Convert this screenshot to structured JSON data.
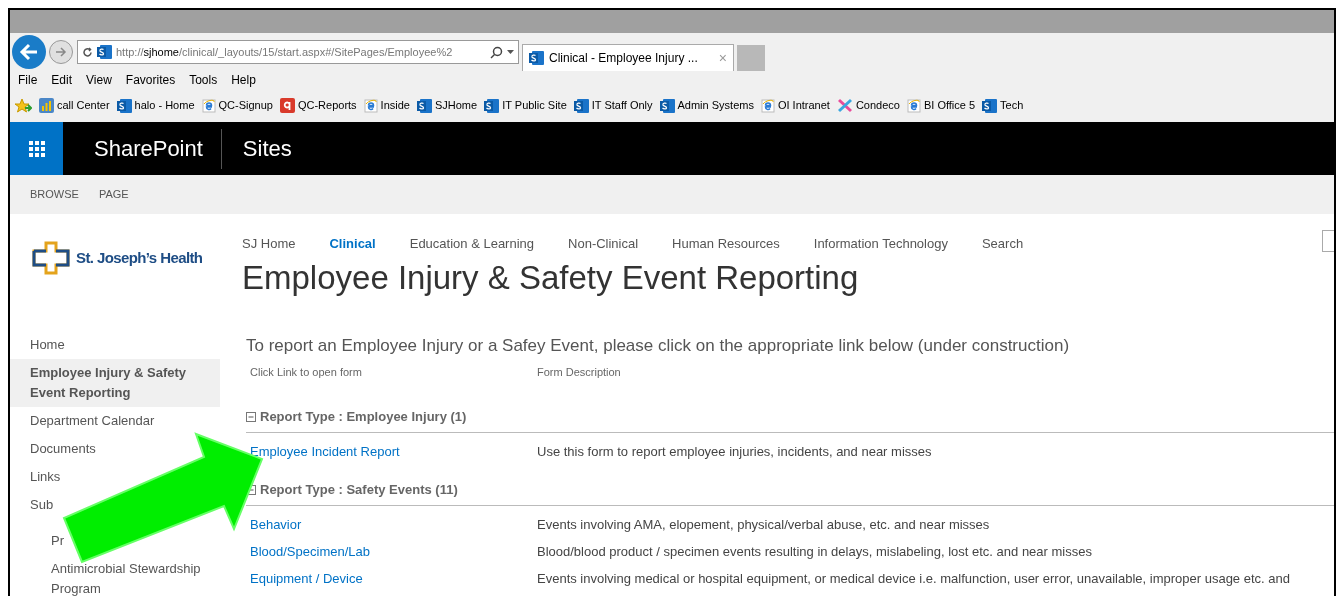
{
  "browser": {
    "address": "http://**sjhome**/clinical/_layouts/15/start.aspx#/SitePages/Employee%2",
    "tabs": [
      {
        "title": "Clinical - Employee Injury ...",
        "selected": true,
        "close": "×"
      }
    ],
    "menu": [
      "File",
      "Edit",
      "View",
      "Favorites",
      "Tools",
      "Help"
    ],
    "favorites": [
      {
        "label": "call Center",
        "kind": "chart"
      },
      {
        "label": "halo - Home",
        "kind": "sp"
      },
      {
        "label": "QC-Signup",
        "kind": "ie"
      },
      {
        "label": "QC-Reports",
        "kind": "q"
      },
      {
        "label": "Inside",
        "kind": "ie"
      },
      {
        "label": "SJHome",
        "kind": "sp"
      },
      {
        "label": "IT Public Site",
        "kind": "sp"
      },
      {
        "label": "IT Staff Only",
        "kind": "sp"
      },
      {
        "label": "Admin Systems",
        "kind": "sp"
      },
      {
        "label": "OI Intranet",
        "kind": "ie"
      },
      {
        "label": "Condeco",
        "kind": "condeco"
      },
      {
        "label": "BI Office 5",
        "kind": "ie"
      },
      {
        "label": "Tech",
        "kind": "sp"
      }
    ]
  },
  "suite_bar": {
    "brand": "SharePoint",
    "section": "Sites"
  },
  "ribbon": {
    "tabs": [
      "BROWSE",
      "PAGE"
    ]
  },
  "logo": {
    "text": "St. Joseph’s Health"
  },
  "sidebar": {
    "items": [
      {
        "label": "Home",
        "selected": false
      },
      {
        "label": "Employee Injury & Safety Event Reporting",
        "selected": true
      },
      {
        "label": "Department Calendar",
        "selected": false
      },
      {
        "label": "Documents",
        "selected": false
      },
      {
        "label": "Links",
        "selected": false
      },
      {
        "label": "Sub",
        "selected": false,
        "children": [
          {
            "label": "Pr",
            "selected": false
          },
          {
            "label": "Antimicrobial Stewardship Program",
            "selected": false
          }
        ]
      }
    ]
  },
  "top_nav": [
    {
      "label": "SJ Home",
      "selected": false
    },
    {
      "label": "Clinical",
      "selected": true
    },
    {
      "label": "Education & Learning",
      "selected": false
    },
    {
      "label": "Non-Clinical",
      "selected": false
    },
    {
      "label": "Human Resources",
      "selected": false
    },
    {
      "label": "Information Technology",
      "selected": false
    },
    {
      "label": "Search",
      "selected": false
    }
  ],
  "page_title": "Employee Injury & Safety Event Reporting",
  "intro": "To report an Employee Injury or a Safey Event, please click on the appropriate link below (under construction)",
  "columns": [
    "Click Link to open form",
    "Form Description"
  ],
  "groups": [
    {
      "heading": "Report Type : **Employee Injury** (1)",
      "expanded": true,
      "rows": [
        {
          "link": "Employee Incident Report",
          "description": "Use this form to report employee injuries, incidents, and near misses"
        }
      ]
    },
    {
      "heading": "Report Type : **Safety Events** (11)",
      "expanded": true,
      "rows": [
        {
          "link": "Behavior",
          "description": "Events involving AMA, elopement, physical/verbal abuse, etc. and near misses"
        },
        {
          "link": "Blood/Specimen/Lab",
          "description": "Blood/blood product / specimen events resulting in delays, mislabeling, lost etc. and near misses"
        },
        {
          "link": "Equipment / Device",
          "description": "Events involving medical or hospital equipment, or medical device i.e. malfunction, user error, unavailable, improper usage etc. and"
        }
      ]
    }
  ]
}
